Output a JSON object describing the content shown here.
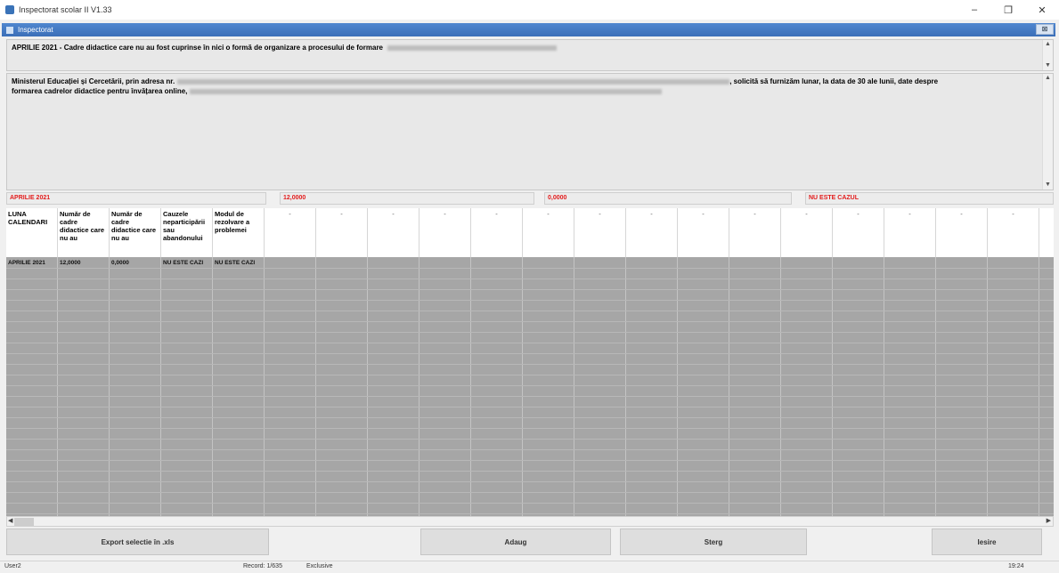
{
  "window": {
    "title": "Inspectorat scolar II V1.33",
    "minimize": "–",
    "maximize": "❐",
    "close": "✕"
  },
  "form": {
    "title": "Inspectorat",
    "close": "⊠"
  },
  "question": {
    "text": "APRILIE 2021 - Cadre didactice care nu au fost cuprinse în nici o formă de organizare a procesului de formare"
  },
  "description": {
    "text_start": "Ministerul Educației și Cercetării, prin adresa nr.",
    "text_mid": ", solicită să furnizăm lunar, la data de 30 ale lunii, date despre",
    "text_line2": "formarea cadrelor didactice pentru învățarea online,"
  },
  "summary": [
    "APRILIE 2021",
    "12,0000",
    "0,0000",
    "NU ESTE CAZUL"
  ],
  "grid": {
    "headers": [
      "LUNA CALENDARI",
      "Număr de cadre didactice care nu au",
      "Număr de cadre didactice care nu au",
      "Cauzele neparticipării sau abandonului",
      "Modul de rezolvare a problemei"
    ],
    "empty_header": "-",
    "rows": [
      [
        "APRILIE 2021",
        "12,0000",
        "0,0000",
        "NU ESTE CAZI",
        "NU ESTE CAZI"
      ]
    ]
  },
  "buttons": {
    "export": "Export selectie în .xls",
    "add": "Adaug",
    "delete": "Sterg",
    "exit": "Iesire"
  },
  "status": {
    "user": "User2",
    "record": "Record: 1/635",
    "mode": "Exclusive",
    "time": "19:24"
  }
}
